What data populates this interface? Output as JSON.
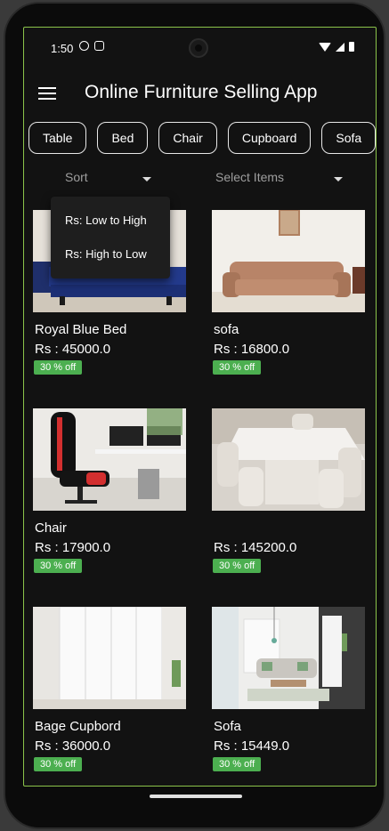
{
  "status_bar": {
    "time": "1:50"
  },
  "app_bar": {
    "title": "Online Furniture Selling App"
  },
  "categories": [
    "Table",
    "Bed",
    "Chair",
    "Cupboard",
    "Sofa"
  ],
  "filters": {
    "sort_label": "Sort",
    "select_label": "Select Items"
  },
  "sort_menu": [
    "Rs: Low to High",
    "Rs: High to Low"
  ],
  "products": [
    {
      "name": "Royal Blue Bed",
      "price": "Rs : 45000.0",
      "discount": "30 % off"
    },
    {
      "name": "sofa",
      "price": "Rs : 16800.0",
      "discount": "30 % off"
    },
    {
      "name": "Chair",
      "price": "Rs : 17900.0",
      "discount": "30 % off"
    },
    {
      "name": "",
      "price": "Rs : 145200.0",
      "discount": "30 % off"
    },
    {
      "name": "Bage Cupbord",
      "price": "Rs : 36000.0",
      "discount": "30 % off"
    },
    {
      "name": "Sofa",
      "price": "Rs : 15449.0",
      "discount": "30 % off"
    }
  ],
  "colors": {
    "accent_border": "#8bc34a",
    "badge": "#4caf50",
    "background": "#121212"
  },
  "icons": [
    "menu-icon",
    "chevron-down-icon",
    "wifi-icon",
    "signal-icon",
    "battery-icon"
  ]
}
